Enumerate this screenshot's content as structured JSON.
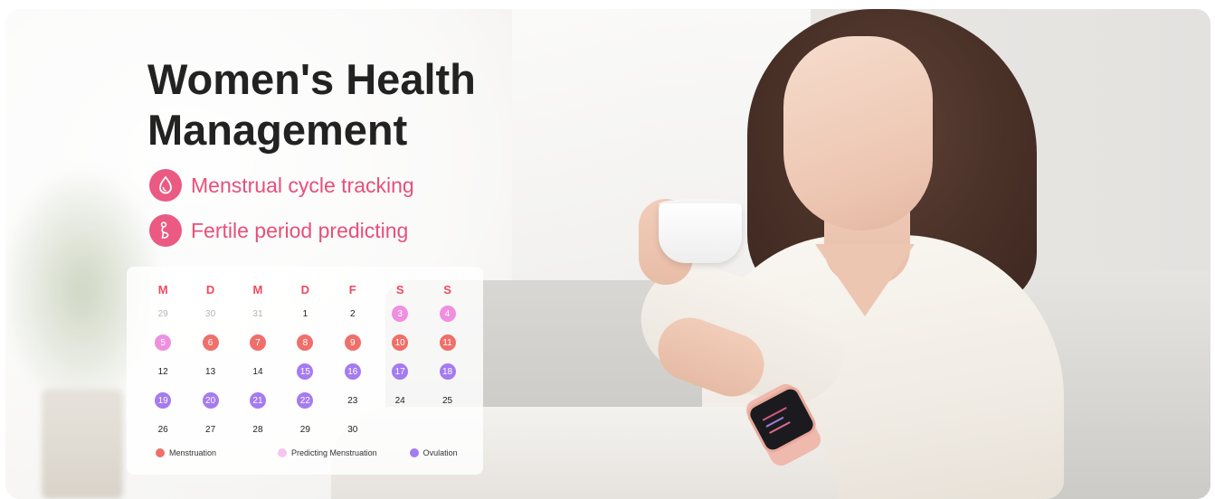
{
  "headline": {
    "line1": "Women's Health",
    "line2": "Management"
  },
  "features": [
    {
      "label": "Menstrual cycle tracking",
      "icon": "droplet-icon"
    },
    {
      "label": "Fertile period predicting",
      "icon": "pregnancy-icon"
    }
  ],
  "calendar": {
    "weekdays": [
      "M",
      "D",
      "M",
      "D",
      "F",
      "S",
      "S"
    ],
    "weeks": [
      [
        {
          "d": "29",
          "t": "muted"
        },
        {
          "d": "30",
          "t": "muted"
        },
        {
          "d": "31",
          "t": "muted"
        },
        {
          "d": "1",
          "t": "plain"
        },
        {
          "d": "2",
          "t": "plain"
        },
        {
          "d": "3",
          "t": "pred"
        },
        {
          "d": "4",
          "t": "pred"
        }
      ],
      [
        {
          "d": "5",
          "t": "pred"
        },
        {
          "d": "6",
          "t": "mens"
        },
        {
          "d": "7",
          "t": "mens"
        },
        {
          "d": "8",
          "t": "mens"
        },
        {
          "d": "9",
          "t": "mens"
        },
        {
          "d": "10",
          "t": "mens"
        },
        {
          "d": "11",
          "t": "mens"
        }
      ],
      [
        {
          "d": "12",
          "t": "plain"
        },
        {
          "d": "13",
          "t": "plain"
        },
        {
          "d": "14",
          "t": "plain"
        },
        {
          "d": "15",
          "t": "ovu"
        },
        {
          "d": "16",
          "t": "ovu"
        },
        {
          "d": "17",
          "t": "ovu"
        },
        {
          "d": "18",
          "t": "ovu"
        }
      ],
      [
        {
          "d": "19",
          "t": "ovu"
        },
        {
          "d": "20",
          "t": "ovu"
        },
        {
          "d": "21",
          "t": "ovu"
        },
        {
          "d": "22",
          "t": "ovu"
        },
        {
          "d": "23",
          "t": "plain"
        },
        {
          "d": "24",
          "t": "plain"
        },
        {
          "d": "25",
          "t": "plain"
        }
      ],
      [
        {
          "d": "26",
          "t": "plain"
        },
        {
          "d": "27",
          "t": "plain"
        },
        {
          "d": "28",
          "t": "plain"
        },
        {
          "d": "29",
          "t": "plain"
        },
        {
          "d": "30",
          "t": "plain"
        },
        {
          "d": "",
          "t": "empty"
        },
        {
          "d": "",
          "t": "empty"
        }
      ]
    ],
    "legend": [
      {
        "label": "Menstruation",
        "color": "#ef6f6a"
      },
      {
        "label": "Predicting Menstruation",
        "color": "#f4c6ef"
      },
      {
        "label": "Ovulation",
        "color": "#a57bf0"
      }
    ]
  },
  "colors": {
    "accent_pink": "#e84f7a",
    "menstruation": "#ef6f6a",
    "predicting": "#ef8fe0",
    "ovulation": "#a57bf0"
  }
}
